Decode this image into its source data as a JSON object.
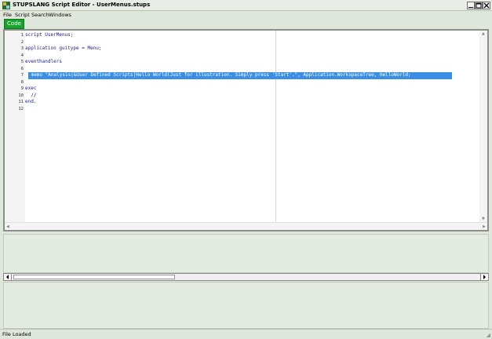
{
  "window": {
    "title": "STUPSLANG Script Editor - UserMenus.stups"
  },
  "menubar": {
    "items": [
      "File",
      "Script",
      "Search",
      "Windows"
    ]
  },
  "tabs": {
    "code_label": "Code"
  },
  "editor": {
    "lines": [
      "script UserMenus;",
      "",
      "application guitype = Menu;",
      "",
      "eventhandlers",
      "",
      " memo \"Analysis|&User Defined Scripts|Hello World(Just for illustration. Simply press 'Start'.\", Application.WorkspaceTree, HelloWorld;",
      "",
      "exec",
      "  //",
      "end.",
      ""
    ],
    "line_numbers": [
      "1",
      "2",
      "3",
      "4",
      "5",
      "6",
      "7",
      "8",
      "9",
      "10",
      "11",
      "12"
    ],
    "highlighted_line": 7
  },
  "status": {
    "text": "File Loaded"
  }
}
